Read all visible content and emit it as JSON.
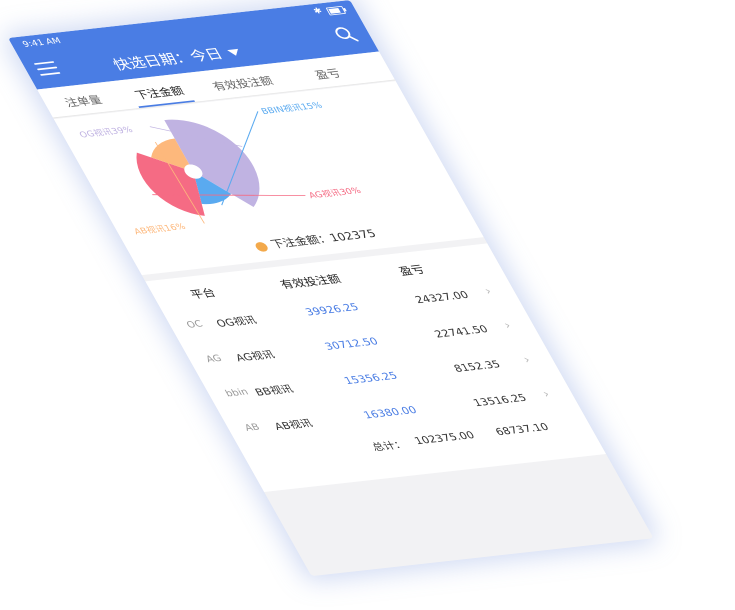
{
  "status": {
    "time": "9:41 AM",
    "bluetooth": "bluetooth-icon",
    "battery": "battery-icon"
  },
  "header": {
    "title": "快选日期：今日",
    "menu_icon": "hamburger-icon",
    "search_icon": "search-icon",
    "color": "#4a7de4"
  },
  "tabs": [
    {
      "label": "注单量"
    },
    {
      "label": "下注金额"
    },
    {
      "label": "有效投注额"
    },
    {
      "label": "盈亏"
    }
  ],
  "chart_data": {
    "type": "pie",
    "series": [
      {
        "name": "OG视讯",
        "value": 39,
        "label": "OG视讯39%",
        "color": "#c0b3e2"
      },
      {
        "name": "BBIN视讯",
        "value": 15,
        "label": "BBIN视讯15%",
        "color": "#5aaaf0"
      },
      {
        "name": "AG视讯",
        "value": 30,
        "label": "AG视讯30%",
        "color": "#f56b84"
      },
      {
        "name": "AB视讯",
        "value": 16,
        "label": "AB视讯16%",
        "color": "#fdb87c"
      }
    ]
  },
  "bet_total": {
    "label": "下注金额：102375"
  },
  "table": {
    "headers": {
      "platform": "平台",
      "valid": "有效投注额",
      "profit": "盈亏"
    },
    "rows": [
      {
        "logo": "OC",
        "platform": "OG视讯",
        "valid": "39926.25",
        "profit": "24327.00"
      },
      {
        "logo": "AG",
        "platform": "AG视讯",
        "valid": "30712.50",
        "profit": "22741.50"
      },
      {
        "logo": "bbin",
        "platform": "BB视讯",
        "valid": "15356.25",
        "profit": "8152.35"
      },
      {
        "logo": "AB",
        "platform": "AB视讯",
        "valid": "16380.00",
        "profit": "13516.25"
      }
    ],
    "total": {
      "label": "总计：",
      "valid": "102375.00",
      "profit": "68737.10"
    }
  }
}
